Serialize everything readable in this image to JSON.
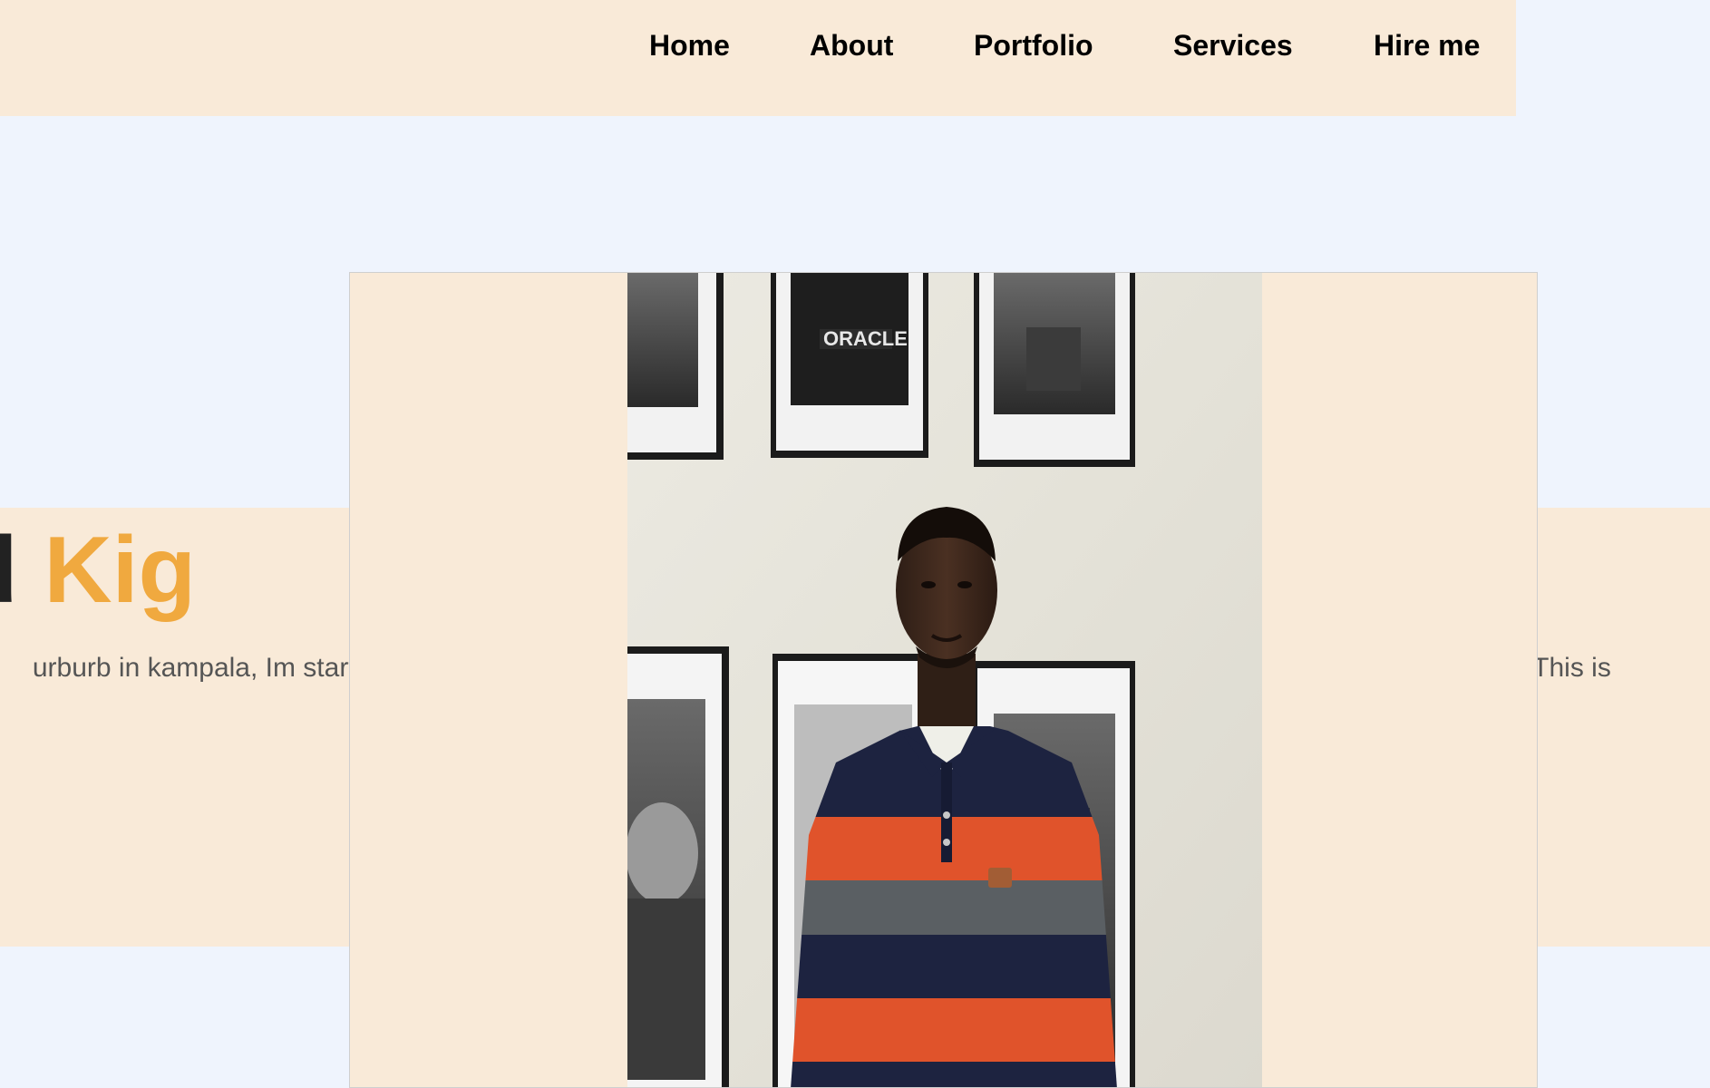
{
  "nav": {
    "items": [
      {
        "label": "Home"
      },
      {
        "label": "About"
      },
      {
        "label": "Portfolio"
      },
      {
        "label": "Services"
      },
      {
        "label": "Hire me"
      }
    ]
  },
  "hero": {
    "title_first": "mond",
    "title_last": "Kig",
    "intro_left": "urburb in kampala, Im startin",
    "intro_right": "orld, This is"
  },
  "photo": {
    "alt": "Portrait of a man in a striped polo shirt standing in front of framed photos"
  },
  "colors": {
    "page_background": "#eff4fd",
    "panel_background": "#f9ead8",
    "accent": "#f0a93f",
    "heading": "#222222",
    "body_text": "#555555"
  }
}
